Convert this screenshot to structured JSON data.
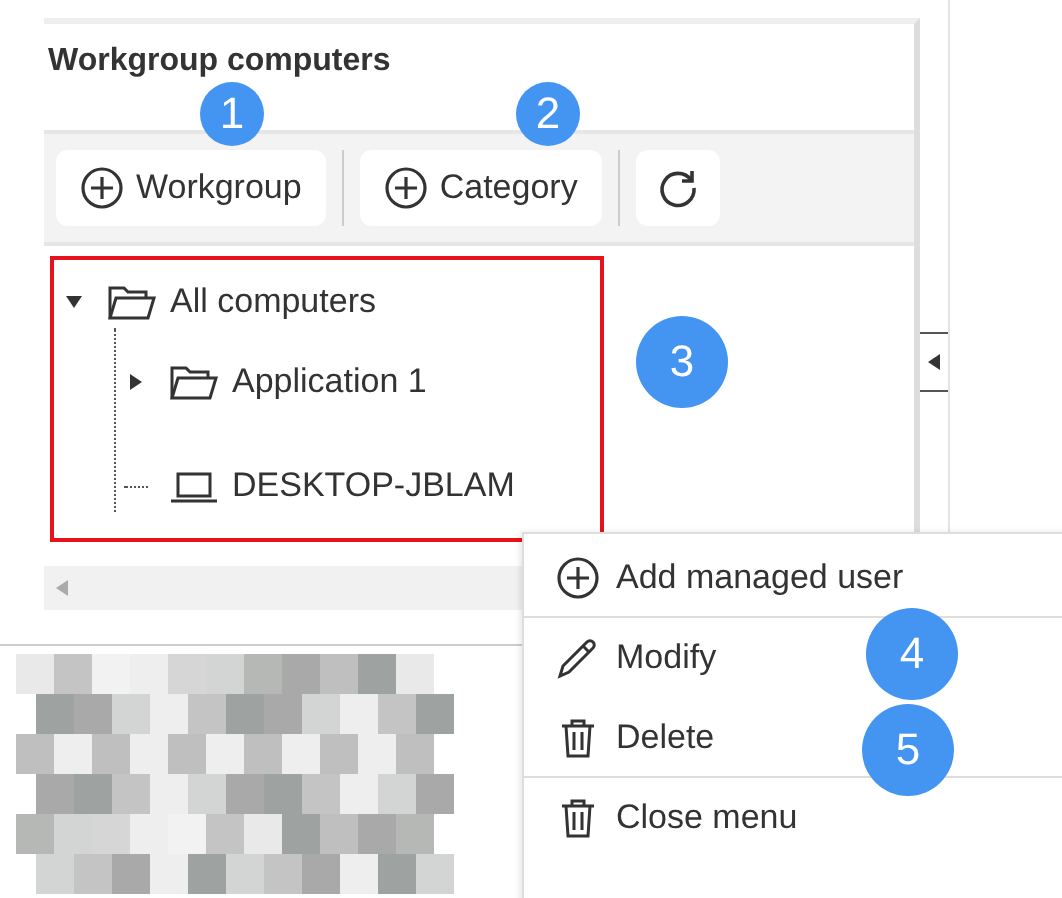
{
  "panel": {
    "title": "Workgroup computers"
  },
  "toolbar": [
    {
      "kind": "add",
      "label": "Workgroup"
    },
    {
      "kind": "add",
      "label": "Category"
    },
    {
      "kind": "refresh"
    }
  ],
  "tree": [
    {
      "label": "All computers",
      "kind": "folder",
      "expanded": true,
      "children": [
        {
          "label": "Application 1",
          "kind": "folder",
          "expanded": false
        },
        {
          "label": "DESKTOP-JBLAM",
          "kind": "computer"
        }
      ]
    }
  ],
  "context_menu": [
    {
      "kind": "add",
      "label": "Add managed user"
    },
    {
      "kind": "edit",
      "label": "Modify"
    },
    {
      "kind": "delete",
      "label": "Delete"
    },
    {
      "kind": "close",
      "label": "Close menu"
    }
  ],
  "callouts": [
    "1",
    "2",
    "3",
    "4",
    "5"
  ]
}
